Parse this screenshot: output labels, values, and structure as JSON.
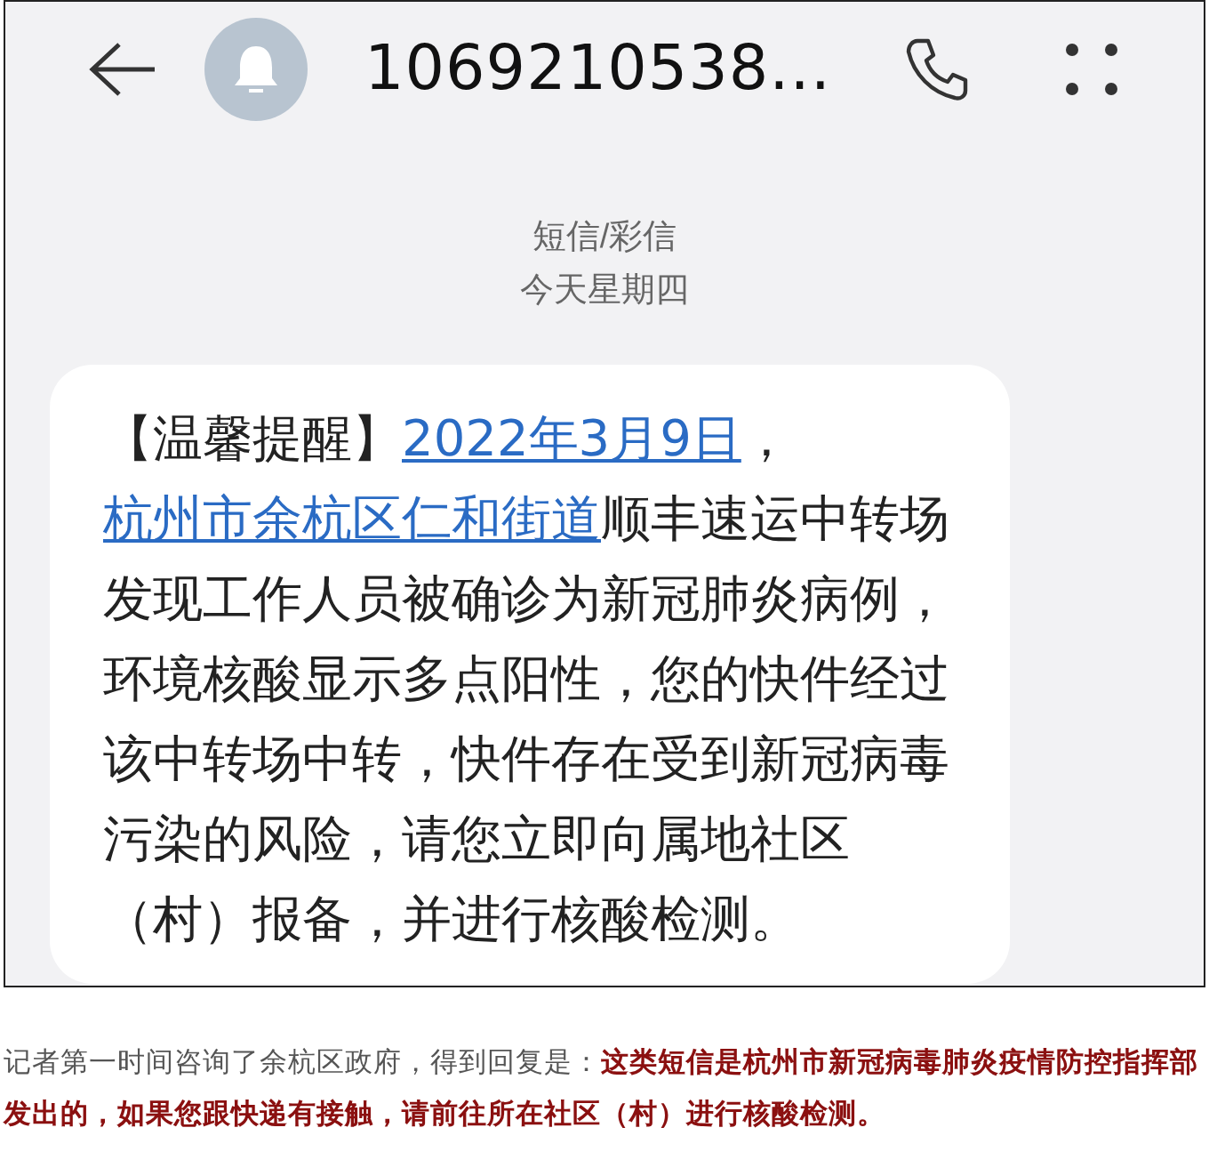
{
  "sms_screen": {
    "sender": "1069210538...",
    "category": "短信/彩信",
    "date": "今天星期四",
    "message": [
      {
        "kind": "plain",
        "text": "【温馨提醒】"
      },
      {
        "kind": "link",
        "text": "2022年3月9日"
      },
      {
        "kind": "plain",
        "text": "，"
      },
      {
        "kind": "link",
        "text": "杭州市余杭区仁和街道"
      },
      {
        "kind": "plain",
        "text": "顺丰速运中转场发现工作人员被确诊为新冠肺炎病例，环境核酸显示多点阳性，您的快件经过该中转场中转，快件存在受到新冠病毒污染的风险，请您立即向属地社区（村）报备，并进行核酸检测。"
      }
    ]
  },
  "caption": "记者第一时间咨询了余杭区政府，得到回复是：**这类短信是杭州市新冠病毒肺炎疫情防控指挥部发出的，如果您跟快递有接触，请前往所在社区（村）进行核酸检测。**"
}
